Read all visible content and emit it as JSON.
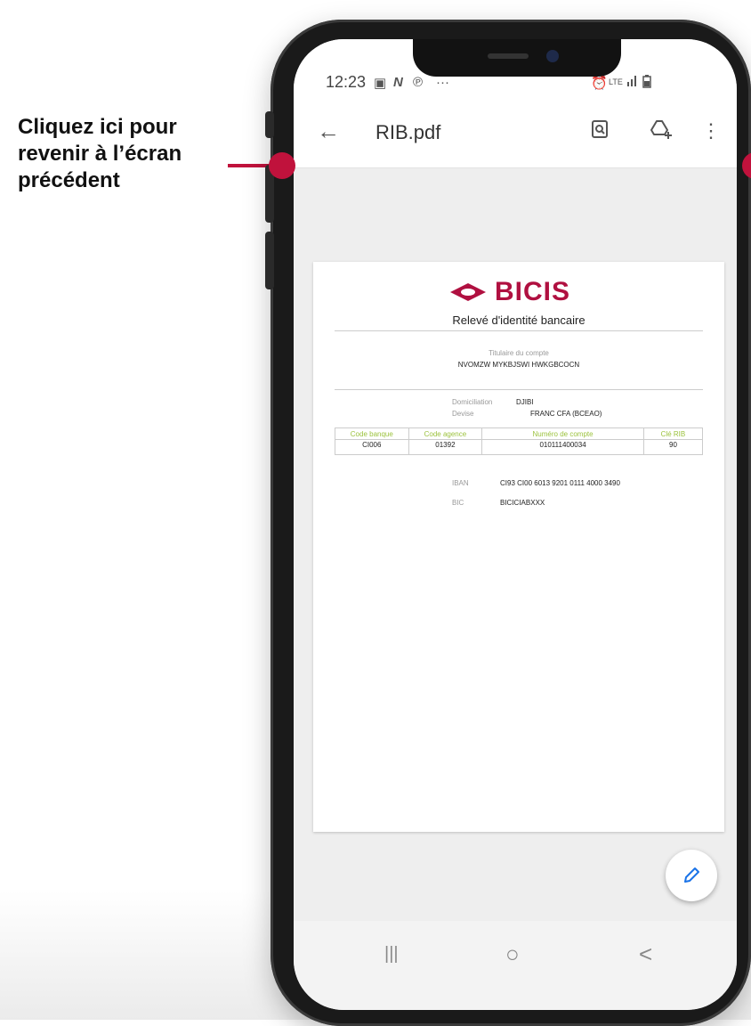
{
  "annotation": {
    "text": "Cliquez ici pour revenir à l’écran précédent",
    "color": "#c0123c"
  },
  "status_bar": {
    "time": "12:23",
    "left_icons": [
      "image-icon",
      "n-icon",
      "pinterest-icon",
      "more-dots-icon"
    ],
    "right_icons": [
      "alarm-icon",
      "lte-icon",
      "signal-icon",
      "battery-icon"
    ]
  },
  "toolbar": {
    "title": "RIB.pdf",
    "icons": [
      "back-arrow-icon",
      "search-document-icon",
      "add-to-drive-icon",
      "more-vert-icon"
    ]
  },
  "document": {
    "brand": "BICIS",
    "brand_color": "#b01040",
    "title": "Relevé d'identité bancaire",
    "holder_label": "Titulaire du compte",
    "holder_name": "NVOMZW MYKBJSWI HWKGBCOCN",
    "domiciliation_label": "Domiciliation",
    "domiciliation_value": "DJIBI",
    "currency_label": "Devise",
    "currency_value": "FRANC CFA (BCEAO)",
    "table_headers": [
      "Code banque",
      "Code agence",
      "Numéro de compte",
      "Clé RIB"
    ],
    "table_values": [
      "CI006",
      "01392",
      "010111400034",
      "90"
    ],
    "iban_label": "IBAN",
    "iban_value": "CI93 CI00 6013 9201 0111 4000 3490",
    "bic_label": "BIC",
    "bic_value": "BICICIABXXX"
  },
  "fab": {
    "icon": "edit-pencil-icon"
  },
  "nav_bar": {
    "recents": "|||",
    "home": "○",
    "back": "<"
  }
}
